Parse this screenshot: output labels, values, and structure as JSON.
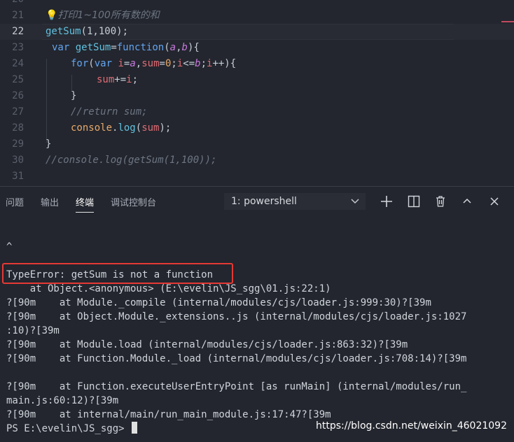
{
  "editor": {
    "top_partial_line": "20",
    "lines": [
      {
        "n": "21",
        "comment_icon": "💡",
        "comment": "打印1~100所有数的和"
      },
      {
        "n": "22",
        "call_fn": "getSum",
        "call_args": "(1,100);"
      },
      {
        "n": "23",
        "kw": "var",
        "name": "getSum",
        "eq": "=",
        "fn_kw": "function",
        "open": "(",
        "p1": "a",
        "comma": ",",
        "p2": "b",
        "close": "){"
      },
      {
        "n": "24",
        "for_kw": "for",
        "paren": "(",
        "var_kw": "var",
        "v1": "i",
        "eq1": "=",
        "a": "a",
        "c1": ",",
        "v2": "sum",
        "eq2": "=",
        "zero": "0",
        "semi1": ";",
        "v3": "i",
        "lte": "<=",
        "b": "b",
        "semi2": ";",
        "v4": "i",
        "inc": "++){"
      },
      {
        "n": "25",
        "v": "sum",
        "op": "+=",
        "v2": "i",
        "semi": ";"
      },
      {
        "n": "26",
        "text": "}"
      },
      {
        "n": "27",
        "comment": "//return sum;"
      },
      {
        "n": "28",
        "obj": "console",
        "dot": ".",
        "m": "log",
        "open": "(",
        "arg": "sum",
        "close": ");"
      },
      {
        "n": "29",
        "text": "}"
      },
      {
        "n": "30",
        "comment": "//console.log(getSum(1,100));"
      },
      {
        "n": "31"
      }
    ]
  },
  "panel": {
    "tabs": [
      "问题",
      "输出",
      "终端",
      "调试控制台"
    ],
    "active_tab": "终端",
    "terminal_select": "1: powershell",
    "icons": [
      "chevron-down-icon",
      "plus-icon",
      "split-icon",
      "trash-icon",
      "chevron-up-icon",
      "close-icon"
    ]
  },
  "terminal": {
    "lines": [
      "^",
      "",
      "TypeError: getSum is not a function",
      "    at Object.<anonymous> (E:\\evelin\\JS_sgg\\01.js:22:1)",
      "?[90m    at Module._compile (internal/modules/cjs/loader.js:999:30)?[39m",
      "?[90m    at Object.Module._extensions..js (internal/modules/cjs/loader.js:1027",
      ":10)?[39m",
      "?[90m    at Module.load (internal/modules/cjs/loader.js:863:32)?[39m",
      "?[90m    at Function.Module._load (internal/modules/cjs/loader.js:708:14)?[39m",
      "",
      "?[90m    at Function.executeUserEntryPoint [as runMain] (internal/modules/run_",
      "main.js:60:12)?[39m",
      "?[90m    at internal/main/run_main_module.js:17:47?[39m",
      "PS E:\\evelin\\JS_sgg> "
    ],
    "watermark": "https://blog.csdn.net/weixin_46021092"
  },
  "colors": {
    "editor_bg": "#23262e",
    "error_highlight": "#e53935",
    "keyword": "#63a4f0",
    "number": "#e9a96b",
    "param": "#c678dd"
  }
}
